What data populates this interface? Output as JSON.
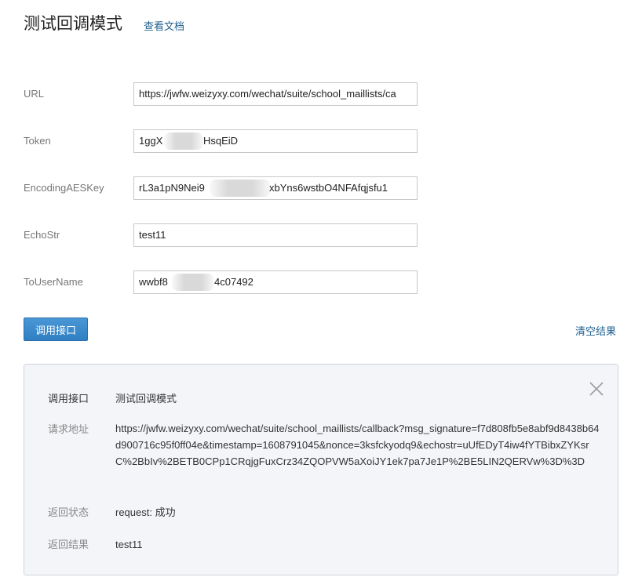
{
  "header": {
    "title": "测试回调模式",
    "doc_link": "查看文档"
  },
  "form": {
    "url": {
      "label": "URL",
      "value": "https://jwfw.weizyxy.com/wechat/suite/school_maillists/ca"
    },
    "token": {
      "label": "Token",
      "value_start": "1ggX",
      "value_end": "HsqEiD"
    },
    "aes_key": {
      "label": "EncodingAESKey",
      "value_start": "rL3a1pN9Nei9",
      "value_end": "xbYns6wstbO4NFAfqjsfu1"
    },
    "echostr": {
      "label": "EchoStr",
      "value": "test11"
    },
    "to_user": {
      "label": "ToUserName",
      "value_start": "wwbf8",
      "value_end": "4c07492"
    }
  },
  "actions": {
    "invoke_label": "调用接口",
    "clear_label": "清空结果"
  },
  "result": {
    "close_icon": "close-icon",
    "rows": [
      {
        "label": "调用接口",
        "value": "测试回调模式"
      },
      {
        "label": "请求地址",
        "value": "https://jwfw.weizyxy.com/wechat/suite/school_maillists/callback?msg_signature=f7d808fb5e8abf9d8438b64d900716c95f0ff04e&timestamp=1608791045&nonce=3ksfckyodq9&echostr=uUfEDyT4iw4fYTBibxZYKsrC%2BbIv%2BETB0CPp1CRqjgFuxCrz34ZQOPVW5aXoiJY1ek7pa7Je1P%2BE5LIN2QERVw%3D%3D"
      },
      {
        "label": "返回状态",
        "value": "request: 成功"
      },
      {
        "label": "返回结果",
        "value": "test11"
      }
    ]
  }
}
